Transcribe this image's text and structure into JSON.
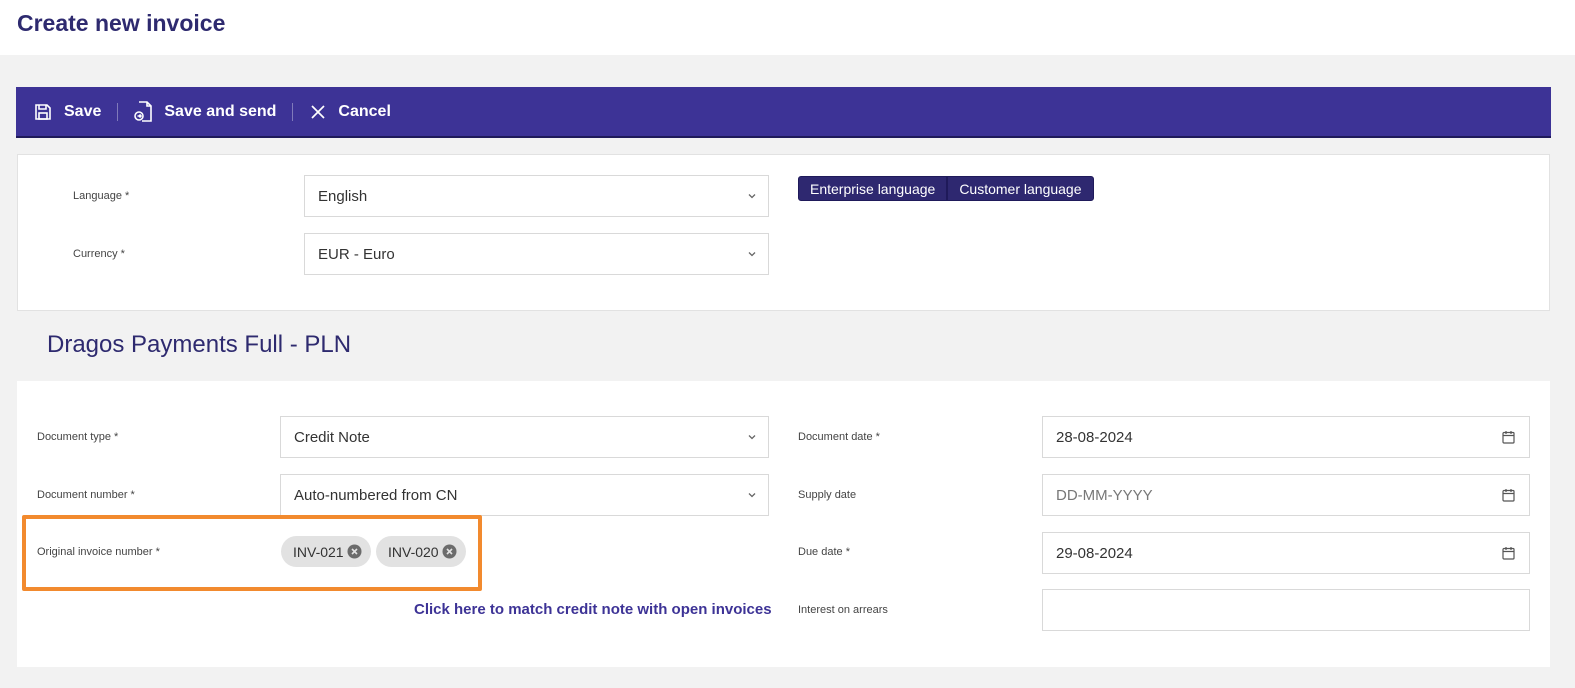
{
  "page": {
    "title": "Create new invoice"
  },
  "toolbar": {
    "save_label": "Save",
    "save_and_send_label": "Save and send",
    "cancel_label": "Cancel"
  },
  "language_card": {
    "language_label": "Language *",
    "language_value": "English",
    "currency_label": "Currency *",
    "currency_value": "EUR - Euro",
    "toggle": [
      "Enterprise language",
      "Customer language"
    ]
  },
  "section": {
    "title": "Dragos Payments Full - PLN"
  },
  "document": {
    "type_label": "Document type *",
    "type_value": "Credit Note",
    "number_label": "Document number *",
    "number_value": "Auto-numbered from CN",
    "original_label": "Original invoice number *",
    "original_chips": [
      "INV-021",
      "INV-020"
    ],
    "match_link": "Click here to match credit note with open invoices",
    "date_label": "Document date *",
    "date_value": "28-08-2024",
    "supply_label": "Supply date",
    "supply_placeholder": "DD-MM-YYYY",
    "due_label": "Due date *",
    "due_value": "29-08-2024",
    "interest_label": "Interest on arrears",
    "interest_value": ""
  },
  "colors": {
    "toolbar_bg": "#3d3396",
    "title": "#2e2a6f",
    "highlight": "#f28a2e",
    "toggle_bg": "#2e2870"
  },
  "icons": {
    "save": "save-icon",
    "save_and_send": "document-send-icon",
    "cancel": "close-icon",
    "dropdown": "chevron-down-icon",
    "calendar": "calendar-icon",
    "chip_remove": "remove-circle-icon"
  }
}
